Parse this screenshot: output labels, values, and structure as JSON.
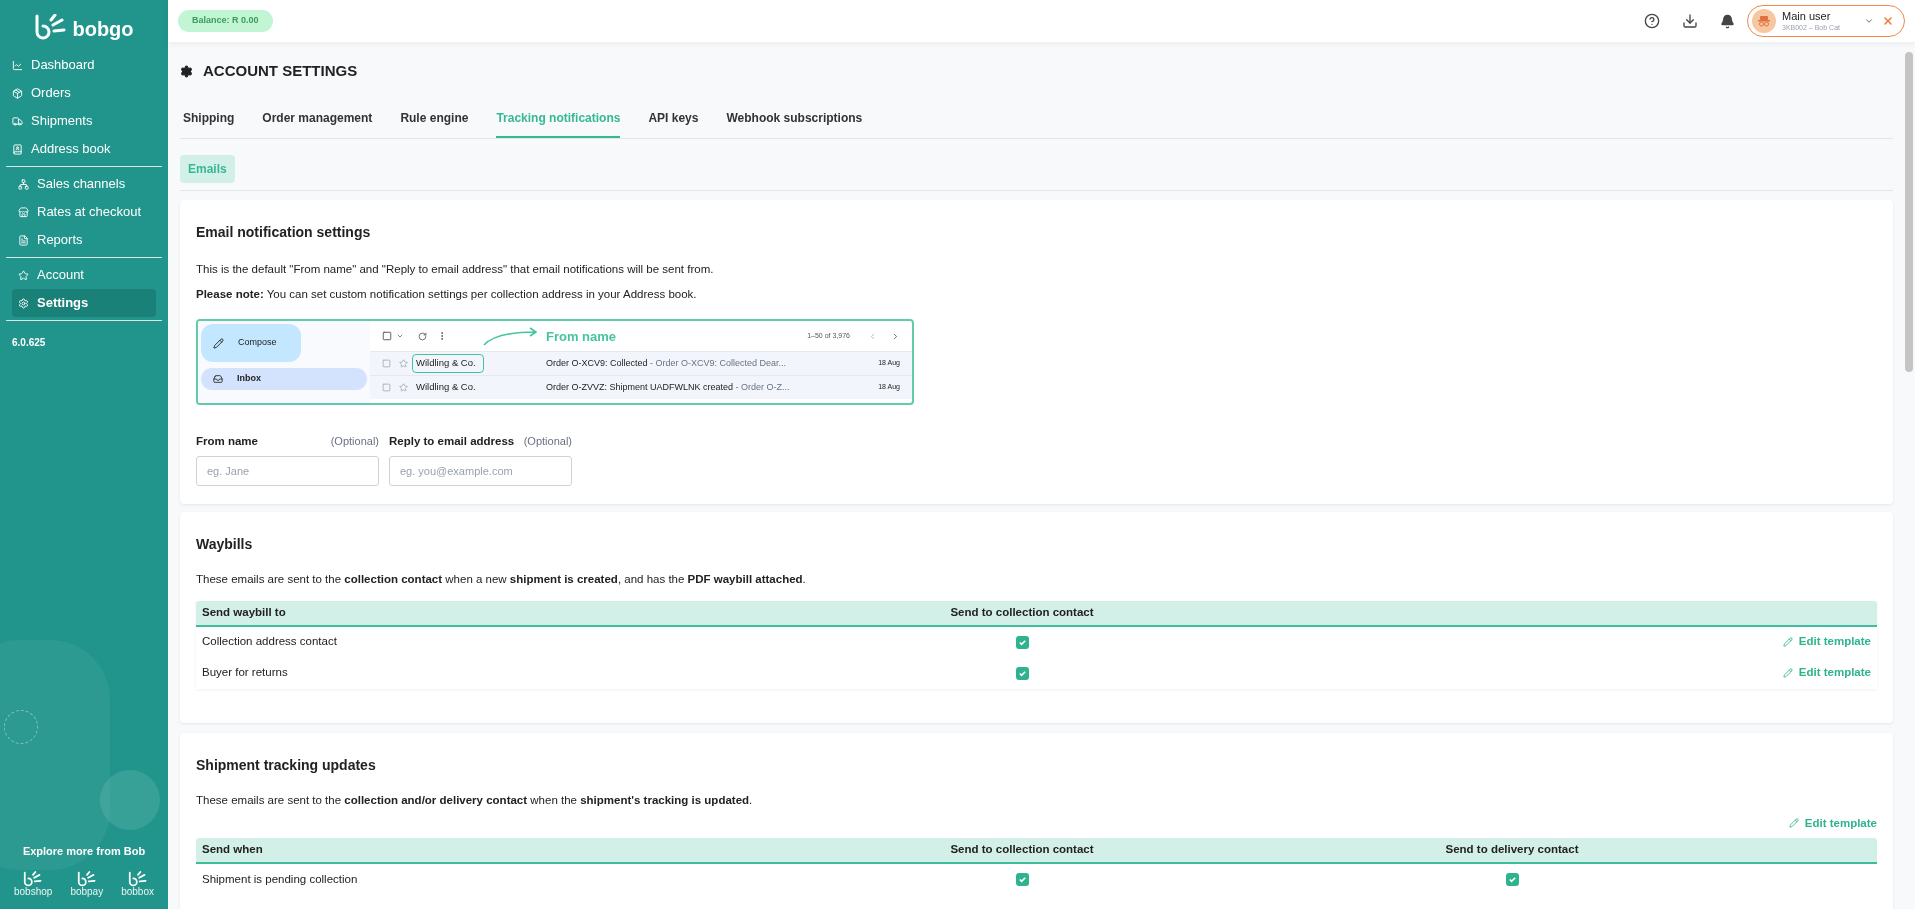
{
  "sidebar": {
    "logo": "bobgo",
    "groups": [
      [
        {
          "label": "Dashboard",
          "selected": false
        },
        {
          "label": "Orders",
          "selected": false
        },
        {
          "label": "Shipments",
          "selected": false
        },
        {
          "label": "Address book",
          "selected": false
        }
      ],
      [
        {
          "label": "Sales channels",
          "selected": false
        },
        {
          "label": "Rates at checkout",
          "selected": false
        },
        {
          "label": "Reports",
          "selected": false
        }
      ],
      [
        {
          "label": "Account",
          "selected": false
        },
        {
          "label": "Settings",
          "selected": true
        }
      ]
    ],
    "version": "6.0.625",
    "explore": {
      "title": "Explore more from Bob",
      "apps": [
        "bobshop",
        "bobpay",
        "bobbox"
      ]
    }
  },
  "topbar": {
    "balance": "Balance: R 0.00",
    "user": {
      "name": "Main user",
      "subtitle": "3KB002 – Bob Cat"
    }
  },
  "page": {
    "title": "ACCOUNT SETTINGS",
    "tabs": [
      {
        "label": "Shipping",
        "selected": false
      },
      {
        "label": "Order management",
        "selected": false
      },
      {
        "label": "Rule engine",
        "selected": false
      },
      {
        "label": "Tracking notifications",
        "selected": true
      },
      {
        "label": "API keys",
        "selected": false
      },
      {
        "label": "Webhook subscriptions",
        "selected": false
      }
    ],
    "subtabs": [
      {
        "label": "Emails",
        "selected": true
      }
    ]
  },
  "email_settings": {
    "title": "Email notification settings",
    "intro": "This is the default \"From name\" and \"Reply to email address\" that email notifications will be sent from.",
    "note": "**Please note:** You can set custom notification settings per collection address in your Address book.",
    "preview": {
      "compose": "Compose",
      "inbox": "Inbox",
      "callout": "From name",
      "pager": "1–50 of 3,976",
      "rows": [
        {
          "sender": "Wildling & Co.",
          "subject": "Order O-XCV9: Collected",
          "snippet": " - Order O-XCV9: Collected Dear...",
          "date": "18 Aug",
          "highlighted": true
        },
        {
          "sender": "Wildling & Co.",
          "subject": "Order O-ZVVZ: Shipment UADFWLNK created",
          "snippet": " - Order O-Z...",
          "date": "18 Aug",
          "highlighted": false
        }
      ]
    },
    "fields": [
      {
        "label": "From name",
        "hint": "(Optional)",
        "placeholder": "eg. Jane"
      },
      {
        "label": "Reply to email address",
        "hint": "(Optional)",
        "placeholder": "eg. you@example.com"
      }
    ]
  },
  "waybills": {
    "title": "Waybills",
    "description": "These emails are sent to the **collection contact** when a new **shipment is created**, and has the **PDF waybill attached**.",
    "columns": [
      "Send waybill to",
      "Send to collection contact"
    ],
    "rows": [
      {
        "label": "Collection address contact",
        "checked": true,
        "action": "Edit template"
      },
      {
        "label": "Buyer for returns",
        "checked": true,
        "action": "Edit template"
      }
    ]
  },
  "tracking": {
    "title": "Shipment tracking updates",
    "description": "These emails are sent to the **collection and/or delivery contact** when the **shipment's tracking is updated**.",
    "action": "Edit template",
    "columns": [
      "Send when",
      "Send to collection contact",
      "Send to delivery contact"
    ],
    "rows": [
      {
        "label": "Shipment is pending collection",
        "collection_checked": true,
        "delivery_checked": true
      }
    ]
  }
}
